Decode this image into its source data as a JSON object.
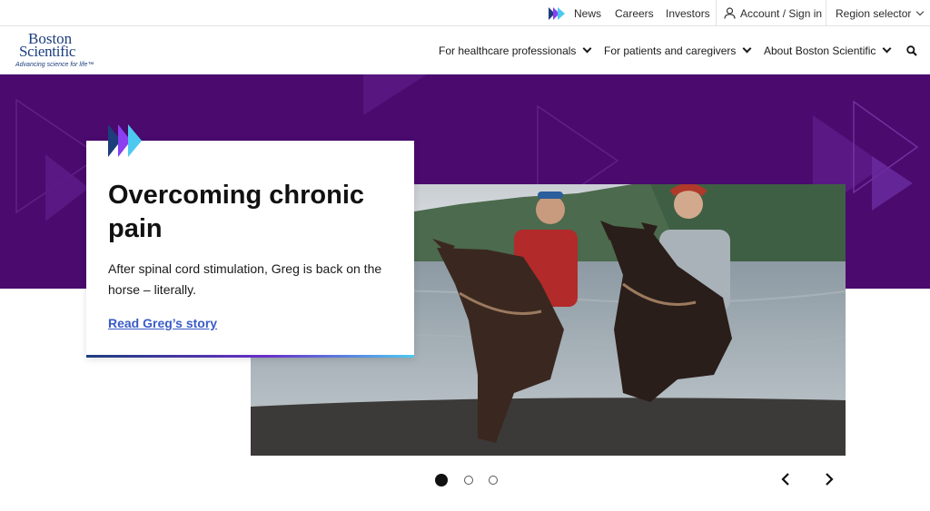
{
  "utility_nav": {
    "news": "News",
    "careers": "Careers",
    "investors": "Investors",
    "account": "Account / Sign in",
    "region": "Region selector"
  },
  "logo": {
    "line1": "Boston",
    "line2": "Scientific",
    "tagline": "Advancing science for life™"
  },
  "main_nav": {
    "hcp": "For healthcare professionals",
    "patients": "For patients and caregivers",
    "about": "About Boston Scientific"
  },
  "hero": {
    "title": "Overcoming chronic pain",
    "text": "After spinal cord stimulation, Greg is back on the horse – literally.",
    "link": "Read Greg’s story"
  },
  "carousel": {
    "slide_count": 3,
    "active_slide": 1
  },
  "colors": {
    "hero_purple": "#4a0a6e",
    "link_blue": "#3a5bc7",
    "brand_navy": "#1c3e7c"
  }
}
